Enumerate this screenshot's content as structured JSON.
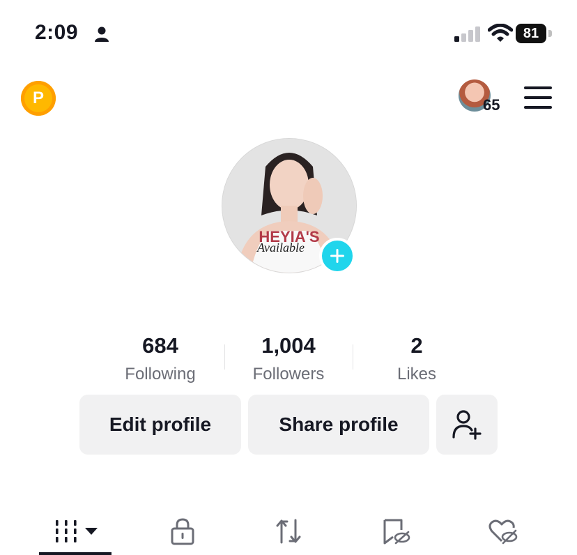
{
  "status_bar": {
    "time": "2:09",
    "battery": "81",
    "icons": [
      "person-icon",
      "signal-icon",
      "wifi-icon",
      "battery-icon"
    ]
  },
  "header": {
    "coin_label": "P",
    "friends_count": "65",
    "icons": [
      "coin-icon",
      "friends-avatar",
      "menu-icon"
    ]
  },
  "profile": {
    "photo_text": "HEYIA'S",
    "photo_subtext": "Available",
    "add_photo_icon": "plus-icon"
  },
  "stats": [
    {
      "value": "684",
      "label": "Following"
    },
    {
      "value": "1,004",
      "label": "Followers"
    },
    {
      "value": "2",
      "label": "Likes"
    }
  ],
  "actions": {
    "edit_profile": "Edit profile",
    "share_profile": "Share profile",
    "add_friend_icon": "add-person-icon"
  },
  "tabs": [
    {
      "icon": "grid-icon",
      "selected": true
    },
    {
      "icon": "lock-icon",
      "selected": false
    },
    {
      "icon": "repost-icon",
      "selected": false
    },
    {
      "icon": "bookmark-hidden-icon",
      "selected": false
    },
    {
      "icon": "heart-hidden-icon",
      "selected": false
    }
  ],
  "colors": {
    "text": "#161823",
    "secondary_text": "#6b6d76",
    "button_bg": "#f1f1f2",
    "accent_plus": "#20d5ec",
    "coin": "#ffb800"
  }
}
